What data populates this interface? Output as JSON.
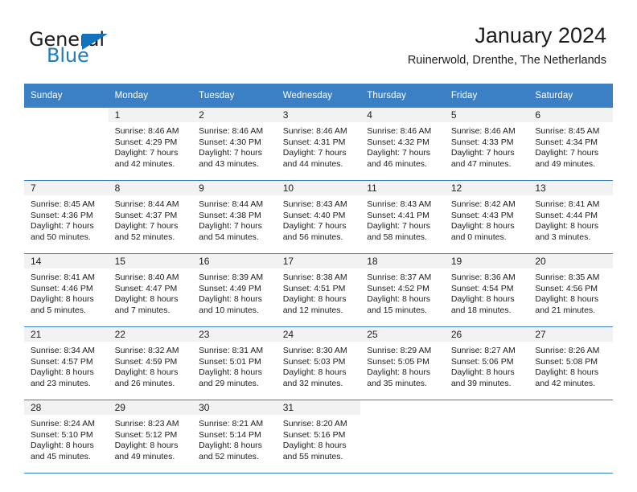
{
  "brand": {
    "word_one": "General",
    "word_two": "Blue",
    "logo_icon": "triangle-logo-icon"
  },
  "header": {
    "title": "January 2024",
    "subtitle": "Ruinerwold, Drenthe, The Netherlands"
  },
  "colors": {
    "header_blue": "#3b7fc4",
    "brand_blue": "#1f7bc1",
    "logo_blue": "#1073bb",
    "daynum_bg": "#f2f2f2",
    "text": "#1c1c1c"
  },
  "weekday_headers": [
    "Sunday",
    "Monday",
    "Tuesday",
    "Wednesday",
    "Thursday",
    "Friday",
    "Saturday"
  ],
  "weeks": [
    [
      {
        "day": "",
        "sunrise": "",
        "sunset": "",
        "daylight_line1": "",
        "daylight_line2": ""
      },
      {
        "day": "1",
        "sunrise": "Sunrise: 8:46 AM",
        "sunset": "Sunset: 4:29 PM",
        "daylight_line1": "Daylight: 7 hours",
        "daylight_line2": "and 42 minutes."
      },
      {
        "day": "2",
        "sunrise": "Sunrise: 8:46 AM",
        "sunset": "Sunset: 4:30 PM",
        "daylight_line1": "Daylight: 7 hours",
        "daylight_line2": "and 43 minutes."
      },
      {
        "day": "3",
        "sunrise": "Sunrise: 8:46 AM",
        "sunset": "Sunset: 4:31 PM",
        "daylight_line1": "Daylight: 7 hours",
        "daylight_line2": "and 44 minutes."
      },
      {
        "day": "4",
        "sunrise": "Sunrise: 8:46 AM",
        "sunset": "Sunset: 4:32 PM",
        "daylight_line1": "Daylight: 7 hours",
        "daylight_line2": "and 46 minutes."
      },
      {
        "day": "5",
        "sunrise": "Sunrise: 8:46 AM",
        "sunset": "Sunset: 4:33 PM",
        "daylight_line1": "Daylight: 7 hours",
        "daylight_line2": "and 47 minutes."
      },
      {
        "day": "6",
        "sunrise": "Sunrise: 8:45 AM",
        "sunset": "Sunset: 4:34 PM",
        "daylight_line1": "Daylight: 7 hours",
        "daylight_line2": "and 49 minutes."
      }
    ],
    [
      {
        "day": "7",
        "sunrise": "Sunrise: 8:45 AM",
        "sunset": "Sunset: 4:36 PM",
        "daylight_line1": "Daylight: 7 hours",
        "daylight_line2": "and 50 minutes."
      },
      {
        "day": "8",
        "sunrise": "Sunrise: 8:44 AM",
        "sunset": "Sunset: 4:37 PM",
        "daylight_line1": "Daylight: 7 hours",
        "daylight_line2": "and 52 minutes."
      },
      {
        "day": "9",
        "sunrise": "Sunrise: 8:44 AM",
        "sunset": "Sunset: 4:38 PM",
        "daylight_line1": "Daylight: 7 hours",
        "daylight_line2": "and 54 minutes."
      },
      {
        "day": "10",
        "sunrise": "Sunrise: 8:43 AM",
        "sunset": "Sunset: 4:40 PM",
        "daylight_line1": "Daylight: 7 hours",
        "daylight_line2": "and 56 minutes."
      },
      {
        "day": "11",
        "sunrise": "Sunrise: 8:43 AM",
        "sunset": "Sunset: 4:41 PM",
        "daylight_line1": "Daylight: 7 hours",
        "daylight_line2": "and 58 minutes."
      },
      {
        "day": "12",
        "sunrise": "Sunrise: 8:42 AM",
        "sunset": "Sunset: 4:43 PM",
        "daylight_line1": "Daylight: 8 hours",
        "daylight_line2": "and 0 minutes."
      },
      {
        "day": "13",
        "sunrise": "Sunrise: 8:41 AM",
        "sunset": "Sunset: 4:44 PM",
        "daylight_line1": "Daylight: 8 hours",
        "daylight_line2": "and 3 minutes."
      }
    ],
    [
      {
        "day": "14",
        "sunrise": "Sunrise: 8:41 AM",
        "sunset": "Sunset: 4:46 PM",
        "daylight_line1": "Daylight: 8 hours",
        "daylight_line2": "and 5 minutes."
      },
      {
        "day": "15",
        "sunrise": "Sunrise: 8:40 AM",
        "sunset": "Sunset: 4:47 PM",
        "daylight_line1": "Daylight: 8 hours",
        "daylight_line2": "and 7 minutes."
      },
      {
        "day": "16",
        "sunrise": "Sunrise: 8:39 AM",
        "sunset": "Sunset: 4:49 PM",
        "daylight_line1": "Daylight: 8 hours",
        "daylight_line2": "and 10 minutes."
      },
      {
        "day": "17",
        "sunrise": "Sunrise: 8:38 AM",
        "sunset": "Sunset: 4:51 PM",
        "daylight_line1": "Daylight: 8 hours",
        "daylight_line2": "and 12 minutes."
      },
      {
        "day": "18",
        "sunrise": "Sunrise: 8:37 AM",
        "sunset": "Sunset: 4:52 PM",
        "daylight_line1": "Daylight: 8 hours",
        "daylight_line2": "and 15 minutes."
      },
      {
        "day": "19",
        "sunrise": "Sunrise: 8:36 AM",
        "sunset": "Sunset: 4:54 PM",
        "daylight_line1": "Daylight: 8 hours",
        "daylight_line2": "and 18 minutes."
      },
      {
        "day": "20",
        "sunrise": "Sunrise: 8:35 AM",
        "sunset": "Sunset: 4:56 PM",
        "daylight_line1": "Daylight: 8 hours",
        "daylight_line2": "and 21 minutes."
      }
    ],
    [
      {
        "day": "21",
        "sunrise": "Sunrise: 8:34 AM",
        "sunset": "Sunset: 4:57 PM",
        "daylight_line1": "Daylight: 8 hours",
        "daylight_line2": "and 23 minutes."
      },
      {
        "day": "22",
        "sunrise": "Sunrise: 8:32 AM",
        "sunset": "Sunset: 4:59 PM",
        "daylight_line1": "Daylight: 8 hours",
        "daylight_line2": "and 26 minutes."
      },
      {
        "day": "23",
        "sunrise": "Sunrise: 8:31 AM",
        "sunset": "Sunset: 5:01 PM",
        "daylight_line1": "Daylight: 8 hours",
        "daylight_line2": "and 29 minutes."
      },
      {
        "day": "24",
        "sunrise": "Sunrise: 8:30 AM",
        "sunset": "Sunset: 5:03 PM",
        "daylight_line1": "Daylight: 8 hours",
        "daylight_line2": "and 32 minutes."
      },
      {
        "day": "25",
        "sunrise": "Sunrise: 8:29 AM",
        "sunset": "Sunset: 5:05 PM",
        "daylight_line1": "Daylight: 8 hours",
        "daylight_line2": "and 35 minutes."
      },
      {
        "day": "26",
        "sunrise": "Sunrise: 8:27 AM",
        "sunset": "Sunset: 5:06 PM",
        "daylight_line1": "Daylight: 8 hours",
        "daylight_line2": "and 39 minutes."
      },
      {
        "day": "27",
        "sunrise": "Sunrise: 8:26 AM",
        "sunset": "Sunset: 5:08 PM",
        "daylight_line1": "Daylight: 8 hours",
        "daylight_line2": "and 42 minutes."
      }
    ],
    [
      {
        "day": "28",
        "sunrise": "Sunrise: 8:24 AM",
        "sunset": "Sunset: 5:10 PM",
        "daylight_line1": "Daylight: 8 hours",
        "daylight_line2": "and 45 minutes."
      },
      {
        "day": "29",
        "sunrise": "Sunrise: 8:23 AM",
        "sunset": "Sunset: 5:12 PM",
        "daylight_line1": "Daylight: 8 hours",
        "daylight_line2": "and 49 minutes."
      },
      {
        "day": "30",
        "sunrise": "Sunrise: 8:21 AM",
        "sunset": "Sunset: 5:14 PM",
        "daylight_line1": "Daylight: 8 hours",
        "daylight_line2": "and 52 minutes."
      },
      {
        "day": "31",
        "sunrise": "Sunrise: 8:20 AM",
        "sunset": "Sunset: 5:16 PM",
        "daylight_line1": "Daylight: 8 hours",
        "daylight_line2": "and 55 minutes."
      },
      {
        "day": "",
        "sunrise": "",
        "sunset": "",
        "daylight_line1": "",
        "daylight_line2": ""
      },
      {
        "day": "",
        "sunrise": "",
        "sunset": "",
        "daylight_line1": "",
        "daylight_line2": ""
      },
      {
        "day": "",
        "sunrise": "",
        "sunset": "",
        "daylight_line1": "",
        "daylight_line2": ""
      }
    ]
  ]
}
